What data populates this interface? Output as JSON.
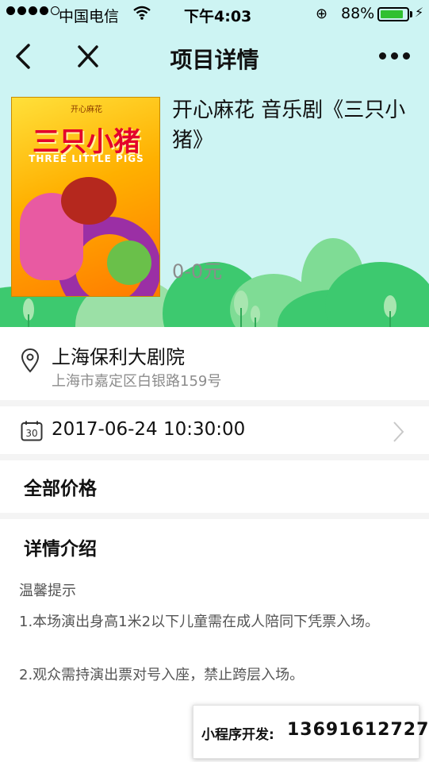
{
  "status_bar": {
    "carrier": "中国电信",
    "time": "下午4:03",
    "battery": "88%",
    "battery_level": 0.88
  },
  "nav": {
    "title": "项目详情"
  },
  "event": {
    "name": "开心麻花 音乐剧《三只小猪》",
    "price": "0-0元",
    "poster": {
      "title": "三只小猪",
      "subtitle": "THREE LITTLE PIGS",
      "top_text": "开心麻花"
    }
  },
  "venue": {
    "name": "上海保利大剧院",
    "address": "上海市嘉定区白银路159号"
  },
  "schedule": {
    "datetime": "2017-06-24 10:30:00",
    "calendar_icon_text": "30"
  },
  "prices_section": {
    "label": "全部价格"
  },
  "details": {
    "heading": "详情介绍",
    "tips_title": "温馨提示",
    "tip1": "1.本场演出身高1米2以下儿童需在成人陪同下凭票入场。",
    "tip2": "2.观众需持演出票对号入座，禁止跨层入场。"
  },
  "contact": {
    "label": "小程序开发:",
    "phone": "13691612727"
  },
  "colors": {
    "header_bg": "#cdf4f3",
    "hill_green": "#3dc96f",
    "hill_light": "#7fdc95",
    "price_gray": "#8c8c8c"
  },
  "icons": [
    "back-icon",
    "close-icon",
    "more-icon",
    "location-pin-icon",
    "calendar-icon",
    "chevron-right-icon",
    "wifi-icon",
    "lock-rotation-icon",
    "battery-icon",
    "charging-icon"
  ]
}
